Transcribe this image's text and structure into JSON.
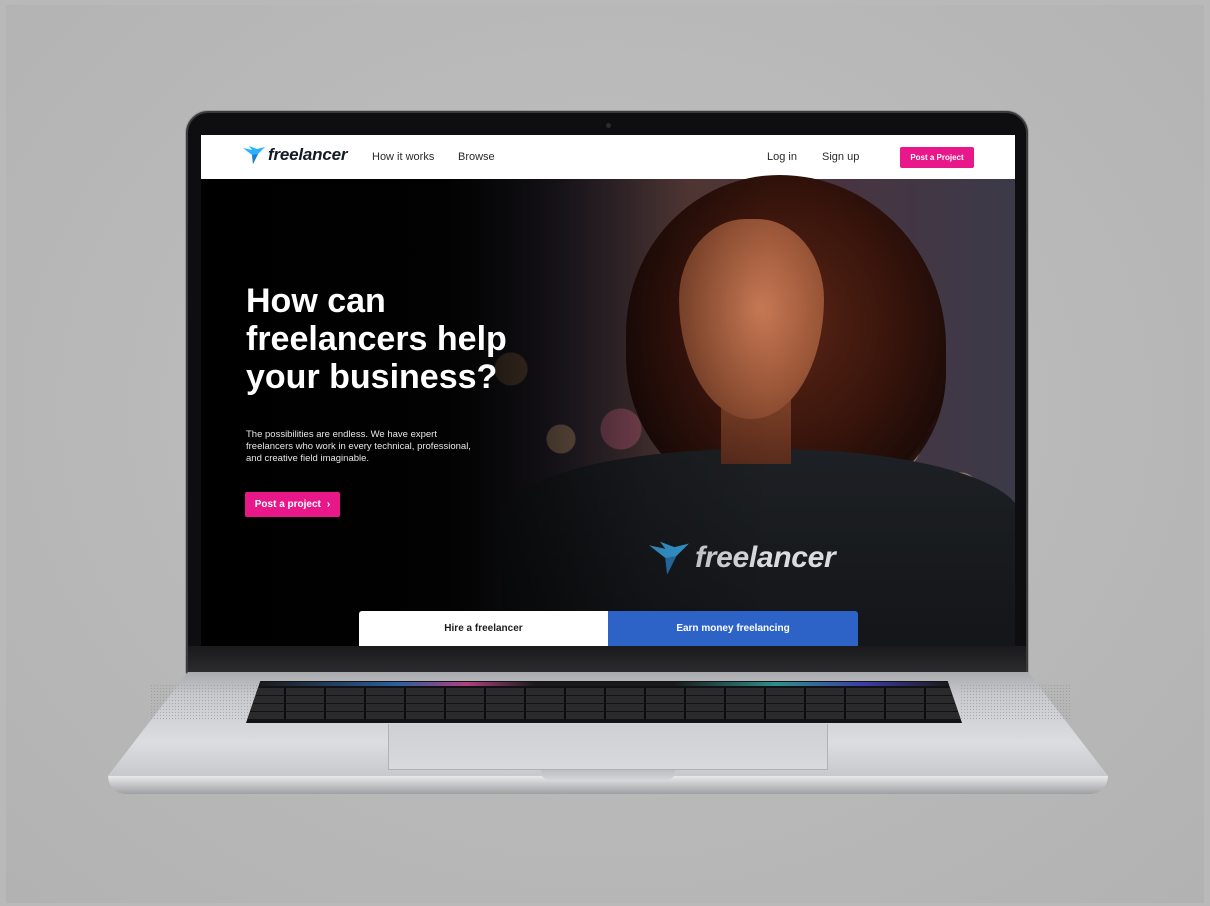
{
  "brand": {
    "logo_text": "freelancer",
    "accent_color": "#e8178a",
    "secondary_color": "#2d63c7"
  },
  "nav": {
    "links": [
      "How it works",
      "Browse"
    ],
    "login": "Log in",
    "signup": "Sign up",
    "cta": "Post a Project"
  },
  "hero": {
    "title": "How can freelancers help your business?",
    "subtitle": "The possibilities are endless. We have expert freelancers who work in every technical, professional, and creative field imaginable.",
    "cta_label": "Post a project",
    "cta_icon": "chevron-right-icon",
    "shirt_logo_text": "freelancer"
  },
  "tabs": {
    "hire": "Hire a freelancer",
    "earn": "Earn money freelancing"
  }
}
